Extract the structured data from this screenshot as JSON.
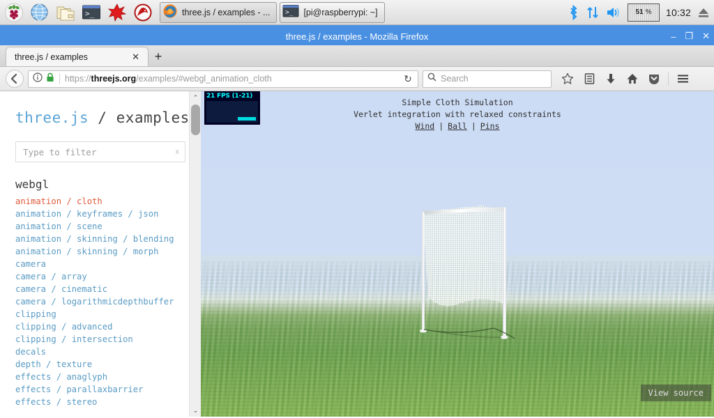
{
  "taskbar": {
    "launchers": [
      {
        "name": "raspberry-menu-icon",
        "label": "Raspberry Pi Menu"
      },
      {
        "name": "globe-browser-icon",
        "label": "Web Browser"
      },
      {
        "name": "file-manager-icon",
        "label": "File Manager"
      },
      {
        "name": "terminal-icon",
        "label": "Terminal"
      },
      {
        "name": "mathematica-icon",
        "label": "Mathematica"
      },
      {
        "name": "wolfram-icon",
        "label": "Wolfram"
      }
    ],
    "windows": [
      {
        "label": "three.js / examples - ...",
        "icon": "firefox-icon",
        "active": true
      },
      {
        "label": "[pi@raspberrypi: ~]",
        "icon": "terminal-icon",
        "active": false
      }
    ],
    "tray": {
      "bluetooth": "bluetooth-icon",
      "network": "network-updown-icon",
      "volume": "volume-icon",
      "cpu_value": "51",
      "cpu_unit": "%",
      "clock": "10:32",
      "eject": "eject-icon"
    }
  },
  "firefox": {
    "window_title": "three.js / examples - Mozilla Firefox",
    "window_controls": {
      "minimize": "–",
      "maximize": "❐",
      "close": "✕"
    },
    "tab": {
      "label": "three.js / examples",
      "close": "✕"
    },
    "new_tab": "+",
    "nav": {
      "back": "←",
      "url_prefix": "https://",
      "url_domain": "threejs.org",
      "url_path": "/examples/#webgl_animation_cloth",
      "url_full": "https://threejs.org/examples/#webgl_animation_cloth",
      "reload": "↻",
      "search_placeholder": "Search",
      "icons": [
        "bookmark-star-icon",
        "library-icon",
        "downloads-icon",
        "home-icon",
        "pocket-icon",
        "hamburger-menu-icon"
      ]
    }
  },
  "sidebar": {
    "title_main": "three.js",
    "title_sep": " / ",
    "title_sub": "examples",
    "filter_placeholder": "Type to filter",
    "filter_clear": "x",
    "group": "webgl",
    "items": [
      {
        "label": "animation / cloth",
        "selected": true
      },
      {
        "label": "animation / keyframes / json",
        "selected": false
      },
      {
        "label": "animation / scene",
        "selected": false
      },
      {
        "label": "animation / skinning / blending",
        "selected": false
      },
      {
        "label": "animation / skinning / morph",
        "selected": false
      },
      {
        "label": "camera",
        "selected": false
      },
      {
        "label": "camera / array",
        "selected": false
      },
      {
        "label": "camera / cinematic",
        "selected": false
      },
      {
        "label": "camera / logarithmicdepthbuffer",
        "selected": false
      },
      {
        "label": "clipping",
        "selected": false
      },
      {
        "label": "clipping / advanced",
        "selected": false
      },
      {
        "label": "clipping / intersection",
        "selected": false
      },
      {
        "label": "decals",
        "selected": false
      },
      {
        "label": "depth / texture",
        "selected": false
      },
      {
        "label": "effects / anaglyph",
        "selected": false
      },
      {
        "label": "effects / parallaxbarrier",
        "selected": false
      },
      {
        "label": "effects / stereo",
        "selected": false
      }
    ],
    "scroll_up": "⌃",
    "scroll_down": "⌄"
  },
  "viewer": {
    "stats_label": "21 FPS (1-21)",
    "title": "Simple Cloth Simulation",
    "subtitle": "Verlet integration with relaxed constraints",
    "controls": [
      {
        "label": "Wind"
      },
      {
        "label": "Ball"
      },
      {
        "label": "Pins"
      }
    ],
    "control_separator": "|",
    "view_source": "View source"
  },
  "colors": {
    "accent_blue": "#4a90e2",
    "link_blue": "#5a9bc4",
    "selected_red": "#e05a3a",
    "sky": "#ccdcf5",
    "grass": "#78a854",
    "stats_cyan": "#00ffff"
  }
}
